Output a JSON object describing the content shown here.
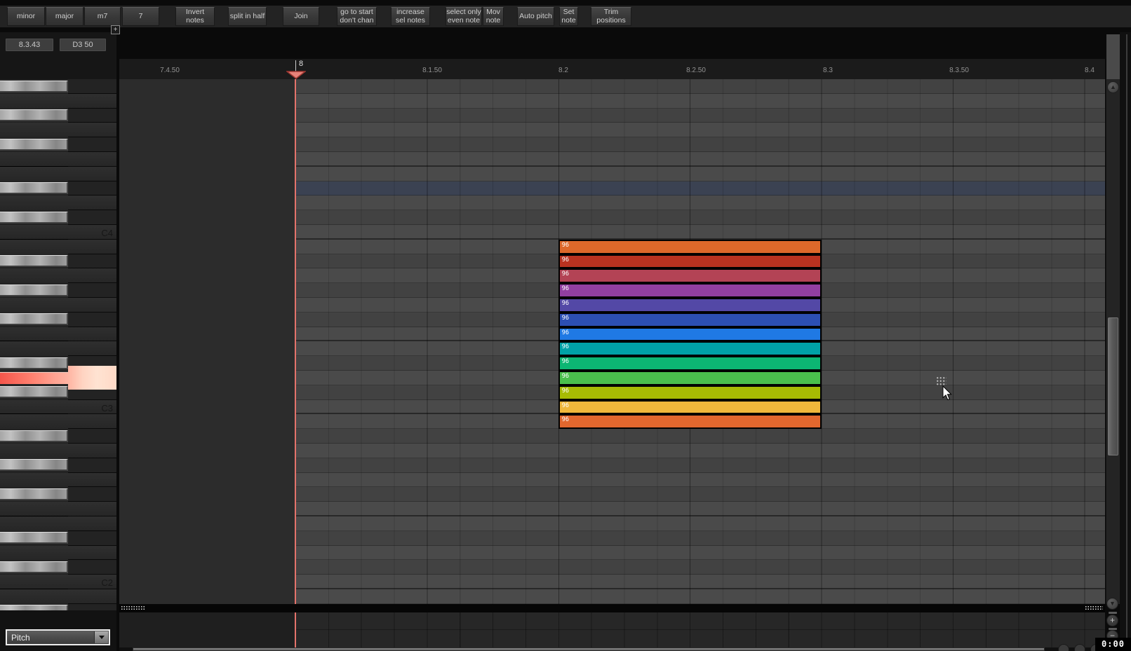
{
  "toolbar": {
    "buttons": [
      {
        "label": "minor"
      },
      {
        "label": "major"
      },
      {
        "label": "m7"
      },
      {
        "label": "7"
      },
      {
        "label": "Invert\nnotes"
      },
      {
        "label": "split in half"
      },
      {
        "label": "Join"
      },
      {
        "label": "go to start\ndon't chan"
      },
      {
        "label": "increase\nsel notes"
      },
      {
        "label": "select only\neven note"
      },
      {
        "label": "Mov\nnote"
      },
      {
        "label": "Auto pitch"
      },
      {
        "label": "Set\nnote"
      },
      {
        "label": "Trim\npositions"
      }
    ]
  },
  "transport": {
    "position": "8.3.43",
    "note_display": "D3 50"
  },
  "ruler": {
    "labels": [
      {
        "text": "7.4.50"
      },
      {
        "text": "8.1.50"
      },
      {
        "text": "8.2"
      },
      {
        "text": "8.2.50"
      },
      {
        "text": "8.3"
      },
      {
        "text": "8.3.50"
      },
      {
        "text": "8.4"
      }
    ],
    "marker_label": "8"
  },
  "piano": {
    "octave_labels": [
      {
        "text": "C4"
      },
      {
        "text": "C3"
      },
      {
        "text": "C2"
      }
    ],
    "highlighted_key": "D3"
  },
  "notes": {
    "items": [
      {
        "velocity": "96",
        "color": "#dd682a"
      },
      {
        "velocity": "96",
        "color": "#b93220"
      },
      {
        "velocity": "96",
        "color": "#b34355"
      },
      {
        "velocity": "96",
        "color": "#923fa1"
      },
      {
        "velocity": "96",
        "color": "#5348a6"
      },
      {
        "velocity": "96",
        "color": "#2c4fb3"
      },
      {
        "velocity": "96",
        "color": "#1f79e4"
      },
      {
        "velocity": "96",
        "color": "#00a2a7"
      },
      {
        "velocity": "96",
        "color": "#0cb673"
      },
      {
        "velocity": "96",
        "color": "#4abf4d"
      },
      {
        "velocity": "96",
        "color": "#a7bb03"
      },
      {
        "velocity": "96",
        "color": "#f0b73b"
      },
      {
        "velocity": "96",
        "color": "#e2672e"
      }
    ]
  },
  "lane": {
    "selector_value": "Pitch",
    "add_button": "+"
  },
  "status": {
    "time": "0:00"
  },
  "colors": {
    "playhead": "#e4736b",
    "row_highlight": "#3b4252",
    "key_highlight_left": "#ff7f6e",
    "key_highlight_right": "#ffd9c6"
  }
}
